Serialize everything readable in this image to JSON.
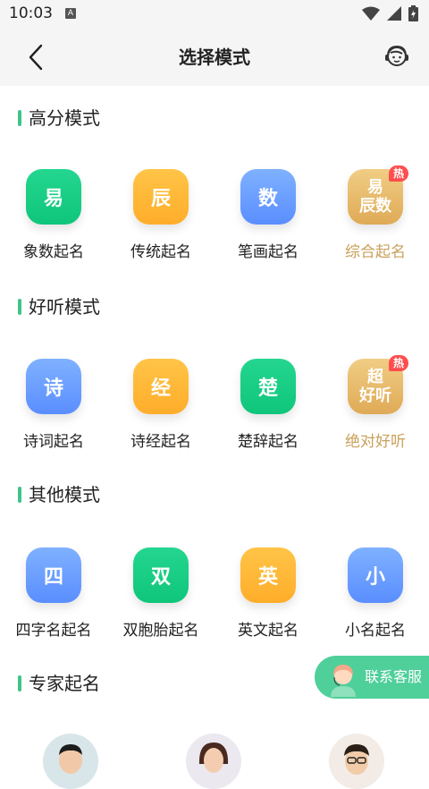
{
  "status": {
    "time": "10:03",
    "notification_glyph": "A"
  },
  "header": {
    "title": "选择模式"
  },
  "sections": [
    {
      "title": "高分模式",
      "items": [
        {
          "tile": "易",
          "label": "象数起名",
          "color": "green"
        },
        {
          "tile": "辰",
          "label": "传统起名",
          "color": "orange"
        },
        {
          "tile": "数",
          "label": "笔画起名",
          "color": "blue"
        },
        {
          "tile_line1": "易",
          "tile_line2": "辰数",
          "label": "综合起名",
          "color": "gold",
          "badge": "热"
        }
      ]
    },
    {
      "title": "好听模式",
      "items": [
        {
          "tile": "诗",
          "label": "诗词起名",
          "color": "blue"
        },
        {
          "tile": "经",
          "label": "诗经起名",
          "color": "orange"
        },
        {
          "tile": "楚",
          "label": "楚辞起名",
          "color": "green"
        },
        {
          "tile_line1": "超",
          "tile_line2": "好听",
          "label": "绝对好听",
          "color": "gold",
          "badge": "热"
        }
      ]
    },
    {
      "title": "其他模式",
      "items": [
        {
          "tile": "四",
          "label": "四字名起名",
          "color": "blue"
        },
        {
          "tile": "双",
          "label": "双胞胎起名",
          "color": "green"
        },
        {
          "tile": "英",
          "label": "英文起名",
          "color": "orange"
        },
        {
          "tile": "小",
          "label": "小名起名",
          "color": "blue"
        }
      ]
    },
    {
      "title": "专家起名"
    }
  ],
  "contact": {
    "label": "联系客服"
  },
  "colors": {
    "accent": "#3fc48a",
    "gold_text": "#c9a05a",
    "hot_badge": "#ff4d4d"
  }
}
